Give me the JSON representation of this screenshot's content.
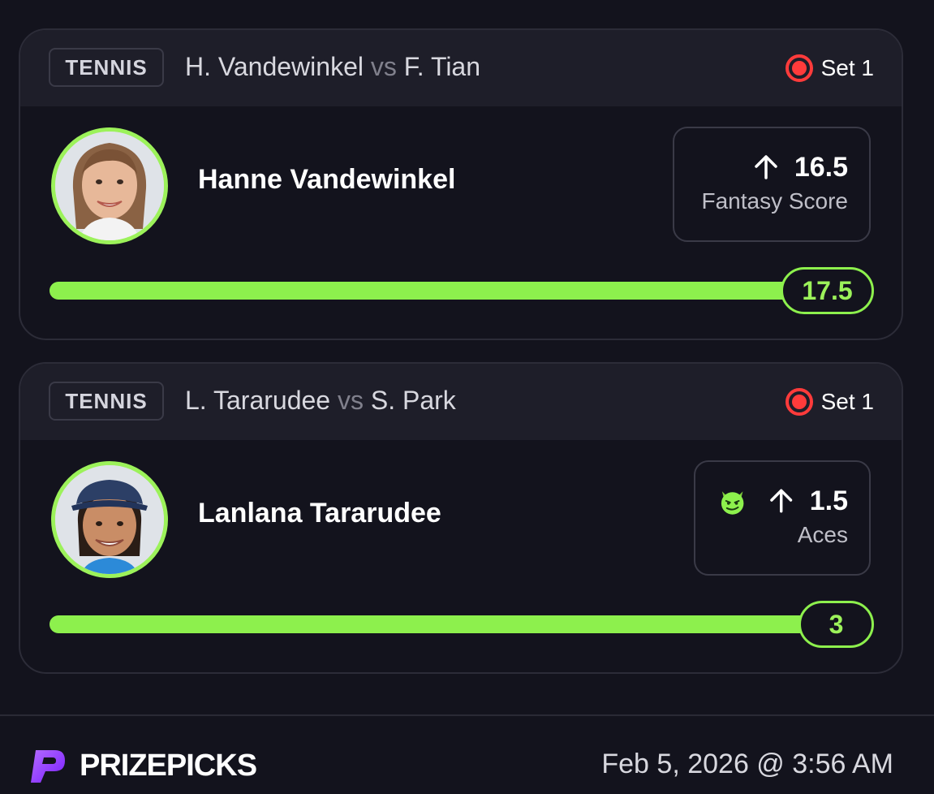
{
  "cards": [
    {
      "sport": "TENNIS",
      "matchup": {
        "player1": "H. Vandewinkel",
        "vs": "vs",
        "player2": "F. Tian"
      },
      "status": "Set 1",
      "player_name": "Hanne Vandewinkel",
      "projection": {
        "direction": "up",
        "line": "16.5",
        "stat": "Fantasy Score",
        "demon": false
      },
      "result": "17.5",
      "progress": 1.0
    },
    {
      "sport": "TENNIS",
      "matchup": {
        "player1": "L. Tararudee",
        "vs": "vs",
        "player2": "S. Park"
      },
      "status": "Set 1",
      "player_name": "Lanlana Tararudee",
      "projection": {
        "direction": "up",
        "line": "1.5",
        "stat": "Aces",
        "demon": true
      },
      "result": "3",
      "progress": 1.0
    }
  ],
  "footer": {
    "brand": "PRIZEPICKS",
    "timestamp": "Feb 5, 2026 @ 3:56 AM"
  },
  "colors": {
    "accent_green": "#8df04d",
    "live_red": "#ff3b3b",
    "brand_purple": "#8a2bff",
    "background": "#13131d"
  },
  "icons": {
    "live": "live-record-icon",
    "arrow": "arrow-up-icon",
    "demon": "demon-icon",
    "logo": "prizepicks-logo-icon"
  }
}
